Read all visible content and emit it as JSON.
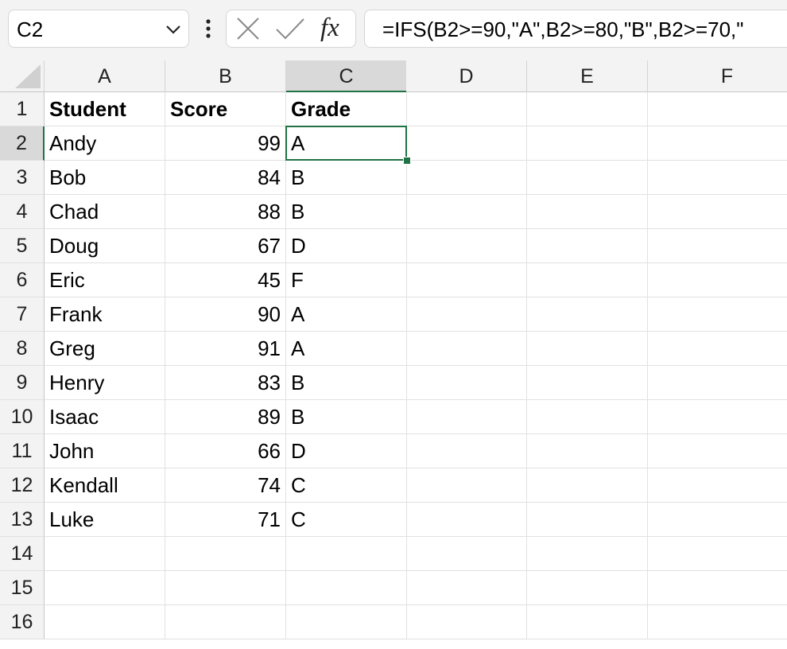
{
  "name_box": {
    "value": "C2"
  },
  "formula_bar": {
    "formula": "=IFS(B2>=90,\"A\",B2>=80,\"B\",B2>=70,\"",
    "fx_label": "fx"
  },
  "icons": {
    "name_box_dropdown": "chevron-down-icon",
    "more_options": "vertical-ellipsis-icon",
    "cancel": "close-icon",
    "enter": "check-icon",
    "insert_function": "fx-icon",
    "select_all": "select-all-triangle-icon"
  },
  "colors": {
    "accent": "#217346",
    "header_bg": "#f3f3f3",
    "header_selected_bg": "#d9d9d9",
    "gridline": "#e1e1e1"
  },
  "grid": {
    "columns": [
      "A",
      "B",
      "C",
      "D",
      "E",
      "F"
    ],
    "row_numbers": [
      "1",
      "2",
      "3",
      "4",
      "5",
      "6",
      "7",
      "8",
      "9",
      "10",
      "11",
      "12",
      "13",
      "14",
      "15",
      "16"
    ],
    "selected_column": "C",
    "selected_row": "2",
    "active_cell": "C2",
    "header": {
      "student": "Student",
      "score": "Score",
      "grade": "Grade"
    },
    "rows": [
      {
        "student": "Andy",
        "score": "99",
        "grade": "A"
      },
      {
        "student": "Bob",
        "score": "84",
        "grade": "B"
      },
      {
        "student": "Chad",
        "score": "88",
        "grade": "B"
      },
      {
        "student": "Doug",
        "score": "67",
        "grade": "D"
      },
      {
        "student": "Eric",
        "score": "45",
        "grade": "F"
      },
      {
        "student": "Frank",
        "score": "90",
        "grade": "A"
      },
      {
        "student": "Greg",
        "score": "91",
        "grade": "A"
      },
      {
        "student": "Henry",
        "score": "83",
        "grade": "B"
      },
      {
        "student": "Isaac",
        "score": "89",
        "grade": "B"
      },
      {
        "student": "John",
        "score": "66",
        "grade": "D"
      },
      {
        "student": "Kendall",
        "score": "74",
        "grade": "C"
      },
      {
        "student": "Luke",
        "score": "71",
        "grade": "C"
      }
    ]
  }
}
